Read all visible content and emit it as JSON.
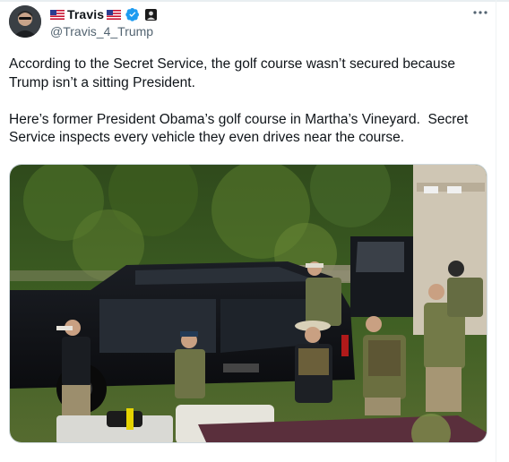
{
  "tweet": {
    "display_name": "Travis",
    "handle": "@Travis_4_Trump",
    "text_para1": "According to the Secret Service, the golf course wasn’t secured because Trump isn’t a sitting President.",
    "text_para2": "Here’s former President Obama’s golf course in Martha’s Vineyard.  Secret Service inspects every vehicle they even drives near the course.",
    "icons": [
      "us-flag-icon",
      "verified-badge-icon",
      "affiliate-badge-icon",
      "more-options-icon"
    ]
  },
  "colors": {
    "verified_blue": "#1d9bf0",
    "text_primary": "#0f1419",
    "text_secondary": "#536471"
  },
  "media": {
    "description_icon": "photo-secret-service-agents-black-suv"
  }
}
